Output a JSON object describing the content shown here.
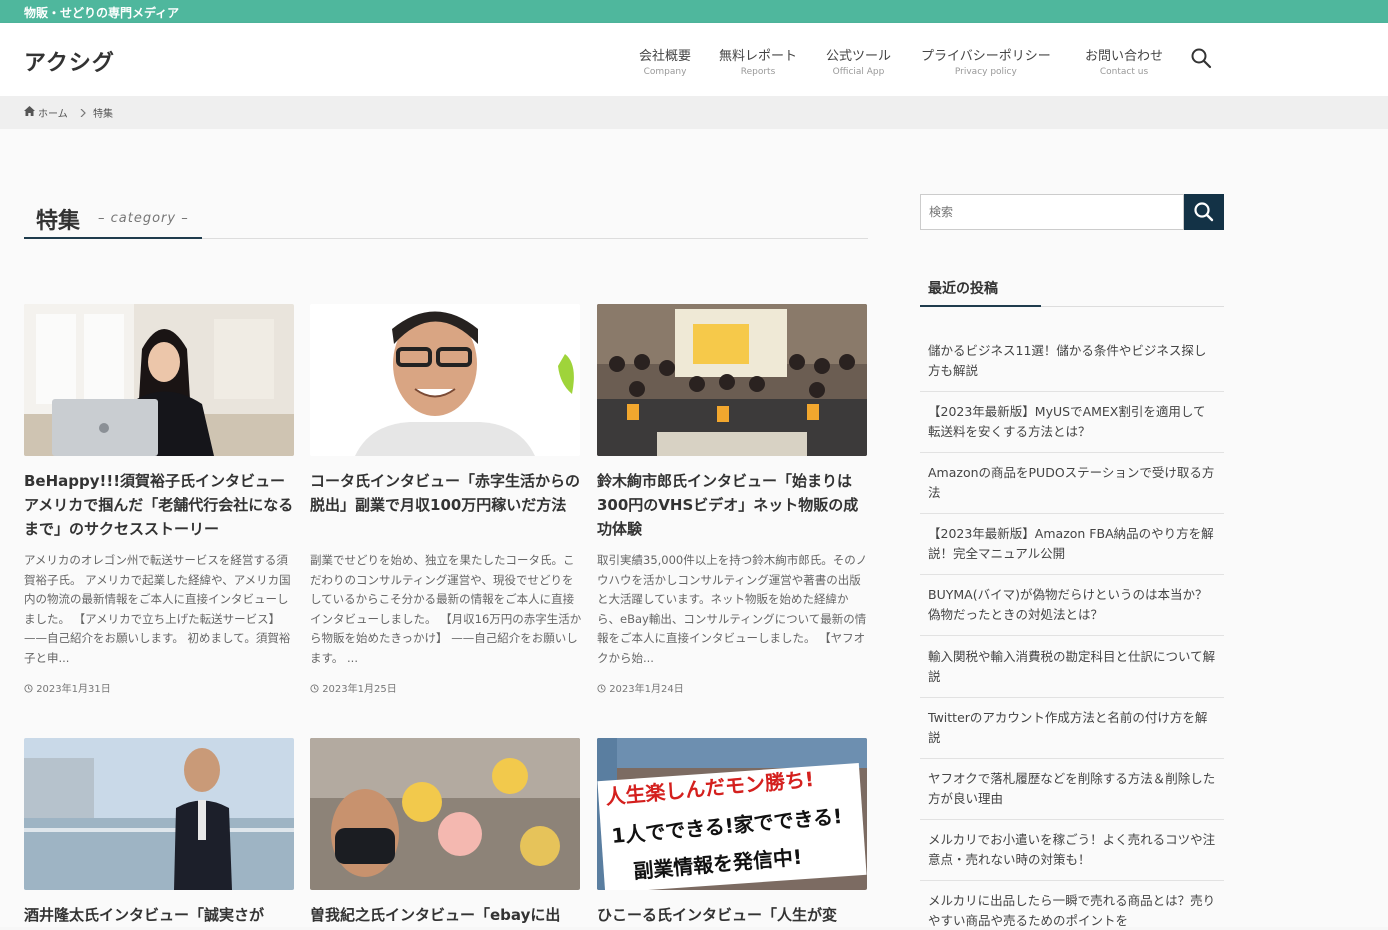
{
  "topbar": {
    "text": "物販・せどりの専門メディア"
  },
  "header": {
    "logo": "アクシグ",
    "nav": [
      {
        "jp": "会社概要",
        "en": "Company"
      },
      {
        "jp": "無料レポート",
        "en": "Reports"
      },
      {
        "jp": "公式ツール",
        "en": "Official App"
      },
      {
        "jp": "プライバシーポリシー",
        "en": "Privacy policy"
      },
      {
        "jp": "お問い合わせ",
        "en": "Contact us"
      }
    ]
  },
  "breadcrumb": {
    "home": "ホーム",
    "current": "特集"
  },
  "page": {
    "title": "特集",
    "subtitle": "– category –"
  },
  "cards": [
    {
      "title": "BeHappy!!!須賀裕子氏インタビュー アメリカで掴んだ「老舗代行会社になるまで」のサクセスストーリー",
      "excerpt": "アメリカのオレゴン州で転送サービスを経営する須賀裕子氏。 アメリカで起業した経緯や、アメリカ国内の物流の最新情報をご本人に直接インタビューしました。 【アメリカで立ち上げた転送サービス】 ——自己紹介をお願いします。 初めまして。須賀裕子と申...",
      "date": "2023年1月31日"
    },
    {
      "title": "コータ氏インタビュー「赤字生活からの脱出」副業で月収100万円稼いだ方法",
      "excerpt": "副業でせどりを始め、独立を果たしたコータ氏。こだわりのコンサルティング運営や、現役でせどりをしているからこそ分かる最新の情報をご本人に直接インタビューしました。 【月収16万円の赤字生活から物販を始めたきっかけ】 ——自己紹介をお願いします。 ...",
      "date": "2023年1月25日"
    },
    {
      "title": "鈴木絢市郎氏インタビュー「始まりは300円のVHSビデオ」ネット物販の成功体験",
      "excerpt": "取引実績35,000件以上を持つ鈴木絢市郎氏。そのノウハウを活かしコンサルティング運営や著書の出版と大活躍しています。ネット物販を始めた経緯から、eBay輸出、コンサルティングについて最新の情報をご本人に直接インタビューしました。 【ヤフオクから始...",
      "date": "2023年1月24日"
    },
    {
      "title": "酒井隆太氏インタビュー「誠実さが",
      "excerpt": "",
      "date": ""
    },
    {
      "title": "曽我紀之氏インタビュー「ebayに出",
      "excerpt": "",
      "date": ""
    },
    {
      "title": "ひこーる氏インタビュー「人生が変",
      "excerpt": "",
      "date": ""
    }
  ],
  "banner": {
    "line1": "人生楽しんだモン勝ち!",
    "line2": "1人でできる!家でできる!",
    "line3": "副業情報を発信中!"
  },
  "sidebar": {
    "search_placeholder": "検索",
    "recent_title": "最近の投稿",
    "posts": [
      "儲かるビジネス11選！儲かる条件やビジネス探し方も解説",
      "【2023年最新版】MyUSでAMEX割引を適用して転送料を安くする方法とは？",
      "Amazonの商品をPUDOステーションで受け取る方法",
      "【2023年最新版】Amazon FBA納品のやり方を解説！完全マニュアル公開",
      "BUYMA(バイマ)が偽物だらけというのは本当か？偽物だったときの対処法とは？",
      "輸入関税や輸入消費税の勘定科目と仕訳について解説",
      "Twitterのアカウント作成方法と名前の付け方を解説",
      "ヤフオクで落札履歴などを削除する方法＆削除した方が良い理由",
      "メルカリでお小遣いを稼ごう！よく売れるコツや注意点・売れない時の対策も！",
      "メルカリに出品したら一瞬で売れる商品とは？売りやすい商品や売るためのポイントを"
    ]
  },
  "colors": {
    "topbar": "#4fb79d",
    "accent": "#1f3c4d",
    "search_button": "#133246"
  }
}
